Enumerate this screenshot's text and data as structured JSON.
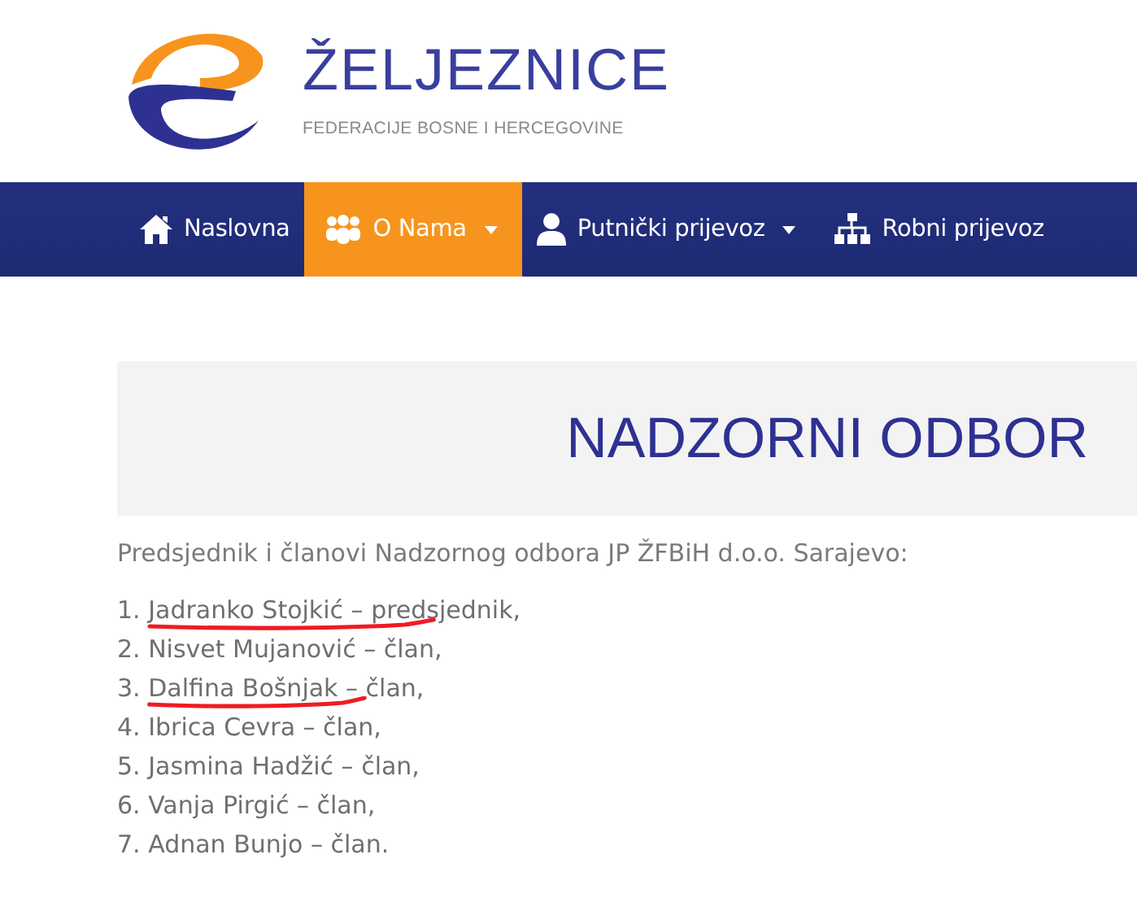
{
  "header": {
    "title": "ŽELJEZNICE",
    "subtitle": "FEDERACIJE BOSNE I HERCEGOVINE"
  },
  "nav": [
    {
      "kind": "home",
      "label": "Naslovna",
      "selected": false,
      "dropdown": false
    },
    {
      "kind": "people",
      "label": "O Nama",
      "selected": true,
      "dropdown": true
    },
    {
      "kind": "person",
      "label": "Putnički prijevoz",
      "selected": false,
      "dropdown": true
    },
    {
      "kind": "sitemap",
      "label": "Robni prijevoz",
      "selected": false,
      "dropdown": false
    }
  ],
  "page_title": "NADZORNI ODBOR",
  "intro": "Predsjednik i članovi Nadzornog odbora JP ŽFBiH d.o.o. Sarajevo:",
  "members": [
    {
      "text": "1. Jadranko Stojkić – predsjednik,",
      "underlined": true
    },
    {
      "text": "2. Nisvet Mujanović – član,",
      "underlined": false
    },
    {
      "text": "3. Dalfina Bošnjak – član,",
      "underlined": true
    },
    {
      "text": "4. Ibrica Cevra – član,",
      "underlined": false
    },
    {
      "text": "5. Jasmina Hadžić – član,",
      "underlined": false
    },
    {
      "text": "6. Vanja Pirgić – član,",
      "underlined": false
    },
    {
      "text": "7. Adnan Bunjo – član.",
      "underlined": false
    }
  ]
}
